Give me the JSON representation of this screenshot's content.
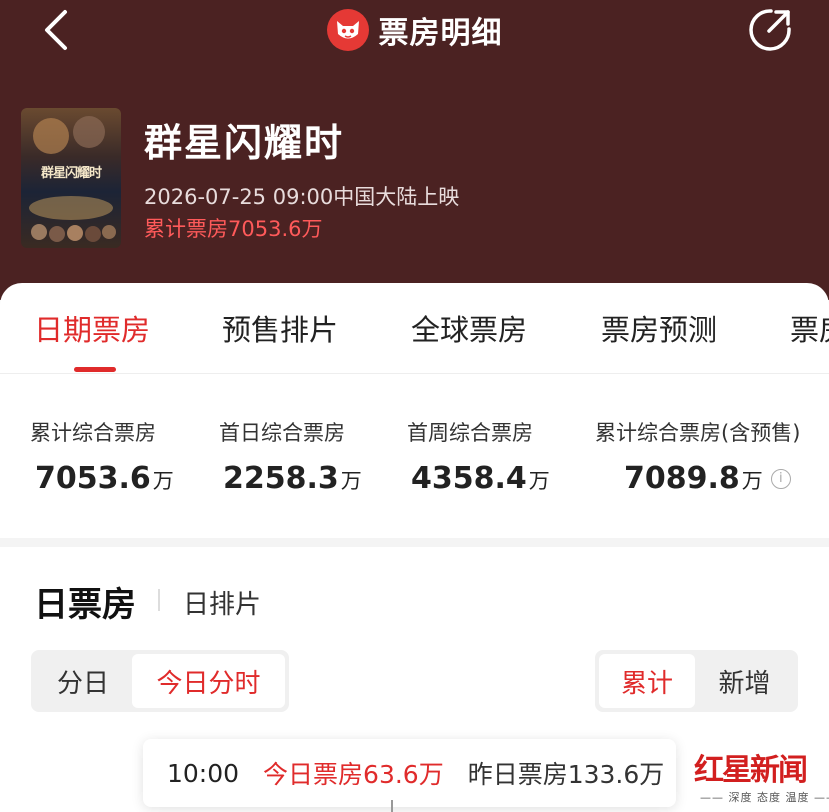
{
  "header": {
    "title": "票房明细",
    "back_icon": "chevron-left-icon",
    "share_icon": "share-icon",
    "logo_icon": "cat-logo-icon",
    "bg_color": "#4b2222"
  },
  "movie": {
    "poster_title": "群星闪耀时",
    "name": "群星闪耀时",
    "release": "2026-07-25 09:00中国大陆上映",
    "total": "累计票房7053.6万"
  },
  "tabs": [
    {
      "label": "日期票房",
      "active": true
    },
    {
      "label": "预售排片",
      "active": false
    },
    {
      "label": "全球票房",
      "active": false
    },
    {
      "label": "票房预测",
      "active": false
    },
    {
      "label": "票房",
      "active": false
    }
  ],
  "stats": [
    {
      "label": "累计综合票房",
      "value": "7053.6",
      "unit": "万"
    },
    {
      "label": "首日综合票房",
      "value": "2258.3",
      "unit": "万"
    },
    {
      "label": "首周综合票房",
      "value": "4358.4",
      "unit": "万"
    },
    {
      "label": "累计综合票房(含预售)",
      "value": "7089.8",
      "unit": "万",
      "info_icon": "info-icon"
    }
  ],
  "section": {
    "title": "日票房",
    "subtitle": "日排片"
  },
  "segments_left": [
    {
      "label": "分日",
      "active": false
    },
    {
      "label": "今日分时",
      "active": true
    }
  ],
  "segments_right": [
    {
      "label": "累计",
      "active": true
    },
    {
      "label": "新增",
      "active": false
    }
  ],
  "tooltip": {
    "time": "10:00",
    "today": "今日票房63.6万",
    "yesterday": "昨日票房133.6万"
  },
  "watermark": {
    "text": "红星新闻",
    "sub": "—— 深度 态度 温度 ——"
  },
  "colors": {
    "accent": "#e02b2b",
    "header": "#4b2222"
  }
}
